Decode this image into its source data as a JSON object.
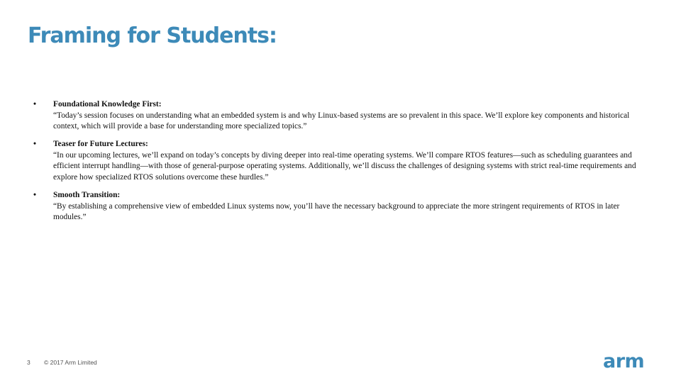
{
  "slide": {
    "title": "Framing for Students:",
    "bullets": [
      {
        "heading": "Foundational Knowledge First:",
        "body": "“Today’s session focuses on understanding what an embedded system is and why Linux-based systems are so prevalent in this space. We’ll explore key components and historical context, which will provide a base for understanding more specialized topics.”"
      },
      {
        "heading": "Teaser for Future Lectures:",
        "body": "“In our upcoming lectures, we’ll expand on today’s concepts by diving deeper into real-time operating systems. We’ll compare RTOS features—such as scheduling guarantees and efficient interrupt handling—with those of general-purpose operating systems. Additionally, we’ll discuss the challenges of designing systems with strict real-time requirements and explore how specialized RTOS solutions overcome these hurdles.”"
      },
      {
        "heading": "Smooth Transition:",
        "body": "“By establishing a comprehensive view of embedded Linux systems now, you’ll have the necessary background to appreciate the more stringent requirements of RTOS in later modules.”"
      }
    ],
    "bullet_symbol": "•"
  },
  "footer": {
    "page_number": "3",
    "copyright": "© 2017 Arm Limited",
    "logo_text": "arm"
  },
  "colors": {
    "accent": "#3d8ab8",
    "body_text": "#111111",
    "footer_text": "#555555"
  }
}
